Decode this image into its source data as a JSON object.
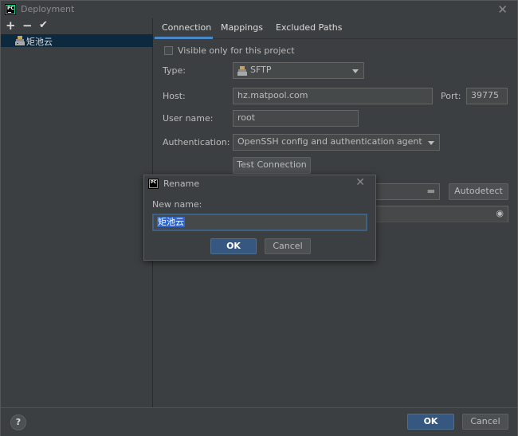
{
  "window": {
    "title": "Deployment",
    "app_icon_text": "PC"
  },
  "toolbar": {
    "add": "+",
    "remove": "−",
    "apply": "✔"
  },
  "tree": {
    "selected_server": "矩池云"
  },
  "tabs": [
    {
      "label": "Connection"
    },
    {
      "label": "Mappings"
    },
    {
      "label": "Excluded Paths"
    }
  ],
  "connection": {
    "visible_only_label": "Visible only for this project",
    "type_label": "Type:",
    "type_value": "SFTP",
    "host_label": "Host:",
    "host_value": "hz.matpool.com",
    "port_label": "Port:",
    "port_value": "39775",
    "username_label": "User name:",
    "username_value": "root",
    "auth_label": "Authentication:",
    "auth_value": "OpenSSH config and authentication agent",
    "test_connection": "Test Connection",
    "autodetect": "Autodetect"
  },
  "rename_dialog": {
    "title": "Rename",
    "app_icon_text": "PC",
    "new_name_label": "New name:",
    "new_name_value": "矩池云",
    "ok": "OK",
    "cancel": "Cancel"
  },
  "footer": {
    "help": "?",
    "ok": "OK",
    "cancel": "Cancel"
  },
  "colors": {
    "background": "#3c3f41",
    "accent": "#4a88c7",
    "primary_button": "#365880",
    "selection": "#0d293e"
  }
}
